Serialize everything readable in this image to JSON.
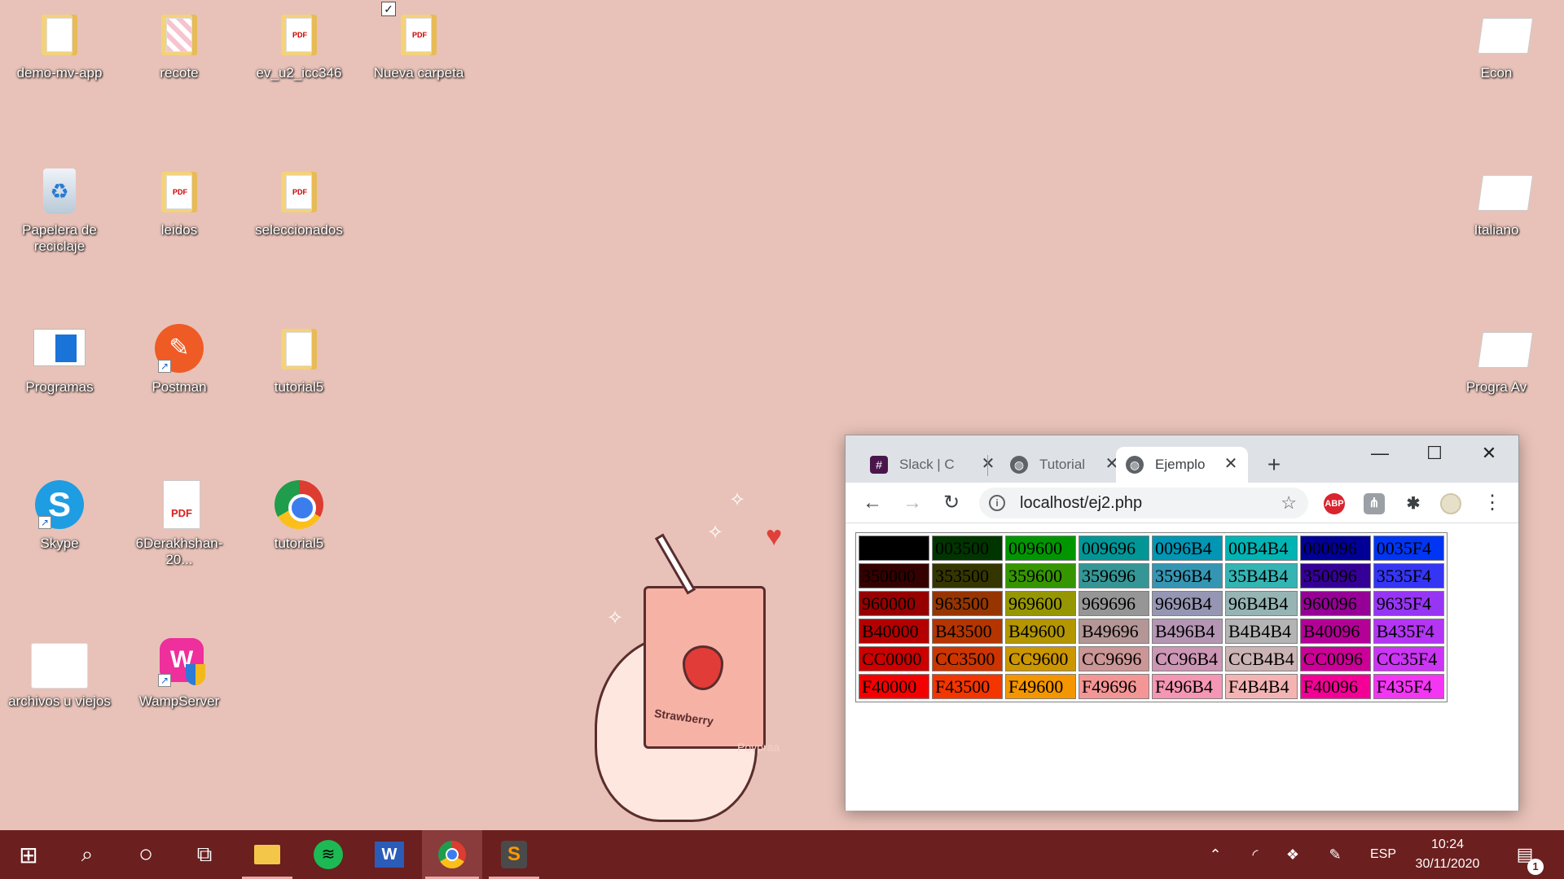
{
  "desktop": {
    "icons": [
      {
        "label": "demo-mv-app"
      },
      {
        "label": "recote"
      },
      {
        "label": "ev_u2_icc346"
      },
      {
        "label": "Nueva carpeta"
      },
      {
        "label": "Papelera de reciclaje"
      },
      {
        "label": "leidos"
      },
      {
        "label": "seleccionados"
      },
      {
        "label": "Programas"
      },
      {
        "label": "Postman"
      },
      {
        "label": "tutorial5"
      },
      {
        "label": "Skype"
      },
      {
        "label": "6Derakhshan-20..."
      },
      {
        "label": "tutorial5"
      },
      {
        "label": "archivos u viejos"
      },
      {
        "label": "WampServer"
      }
    ],
    "right_icons": [
      {
        "label": "Econ"
      },
      {
        "label": "Italiano"
      },
      {
        "label": "Progra Av"
      }
    ],
    "wallpaper": {
      "box_text": "Strawberry",
      "watermark": "Povpraa",
      "background": "#e8c2b8"
    }
  },
  "browser": {
    "tabs": [
      {
        "label": "Slack | C",
        "icon": "slack-icon"
      },
      {
        "label": "Tutorial",
        "icon": "globe-icon"
      },
      {
        "label": "Ejemplo",
        "icon": "globe-icon",
        "active": true
      }
    ],
    "url": "localhost/ej2.php",
    "extensions": [
      {
        "name": "adblock-icon",
        "text": "ABP"
      },
      {
        "name": "extension-icon",
        "text": "⋔"
      },
      {
        "name": "puzzle-icon",
        "text": "✱"
      }
    ],
    "color_table": [
      [
        "000000",
        "003500",
        "009600",
        "009696",
        "0096B4",
        "00B4B4",
        "000096",
        "0035F4"
      ],
      [
        "350000",
        "353500",
        "359600",
        "359696",
        "3596B4",
        "35B4B4",
        "350096",
        "3535F4"
      ],
      [
        "960000",
        "963500",
        "969600",
        "969696",
        "9696B4",
        "96B4B4",
        "960096",
        "9635F4"
      ],
      [
        "B40000",
        "B43500",
        "B49600",
        "B49696",
        "B496B4",
        "B4B4B4",
        "B40096",
        "B435F4"
      ],
      [
        "CC0000",
        "CC3500",
        "CC9600",
        "CC9696",
        "CC96B4",
        "CCB4B4",
        "CC0096",
        "CC35F4"
      ],
      [
        "F40000",
        "F43500",
        "F49600",
        "F49696",
        "F496B4",
        "F4B4B4",
        "F40096",
        "F435F4"
      ]
    ]
  },
  "taskbar": {
    "apps": [
      {
        "name": "start-button"
      },
      {
        "name": "search-button"
      },
      {
        "name": "cortana-button"
      },
      {
        "name": "task-view-button"
      },
      {
        "name": "file-explorer"
      },
      {
        "name": "spotify"
      },
      {
        "name": "word"
      },
      {
        "name": "chrome",
        "active": true
      },
      {
        "name": "sublime-text"
      }
    ],
    "language": "ESP",
    "time": "10:24",
    "date": "30/11/2020",
    "notifications": "1"
  }
}
